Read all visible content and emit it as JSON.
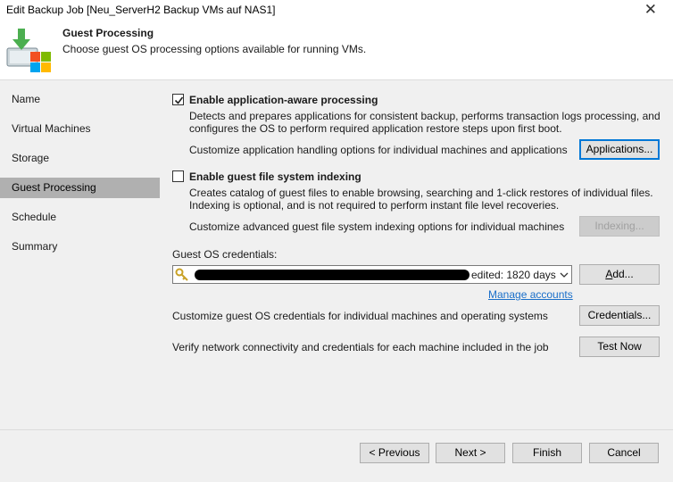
{
  "window": {
    "title": "Edit Backup Job [Neu_ServerH2 Backup VMs auf NAS1]",
    "close_glyph": "✕"
  },
  "header": {
    "title": "Guest Processing",
    "subtitle": "Choose guest OS processing options available for running VMs.",
    "icon": "backup-job-wizard-icon"
  },
  "sidebar": {
    "items": [
      {
        "label": "Name",
        "active": false
      },
      {
        "label": "Virtual Machines",
        "active": false
      },
      {
        "label": "Storage",
        "active": false
      },
      {
        "label": "Guest Processing",
        "active": true
      },
      {
        "label": "Schedule",
        "active": false
      },
      {
        "label": "Summary",
        "active": false
      }
    ]
  },
  "app_aware": {
    "checked": true,
    "label": "Enable application-aware processing",
    "desc_line1": "Detects and prepares applications for consistent backup, performs transaction logs processing, and",
    "desc_line2": "configures the OS to perform required application restore steps upon first boot.",
    "customize": "Customize application handling options for individual machines and applications",
    "button": "Applications..."
  },
  "indexing": {
    "checked": false,
    "label": "Enable guest file system indexing",
    "desc_line1": "Creates catalog of guest files to enable browsing, searching and 1-click restores of individual files.",
    "desc_line2": "Indexing is optional, and is not required to perform instant file level recoveries.",
    "customize": "Customize advanced guest file system indexing options for individual machines",
    "button": "Indexing..."
  },
  "credentials": {
    "label": "Guest OS credentials:",
    "value_visible": "edited: 1820 days",
    "add_button": "Add...",
    "manage_link": "Manage accounts",
    "customize": "Customize guest OS credentials for individual machines and operating systems",
    "credentials_button": "Credentials...",
    "verify": "Verify network connectivity and credentials for each machine included in the job",
    "test_button": "Test Now"
  },
  "footer": {
    "previous": "< Previous",
    "next": "Next >",
    "finish": "Finish",
    "cancel": "Cancel"
  }
}
